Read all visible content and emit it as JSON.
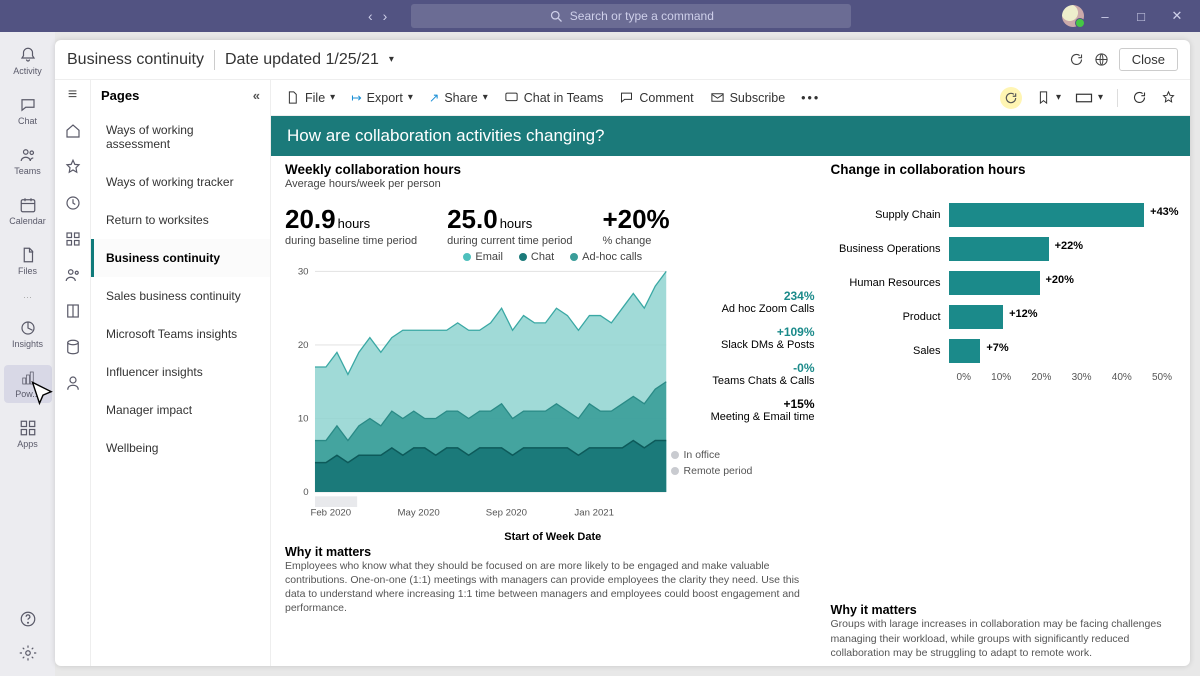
{
  "search_placeholder": "Search or type a command",
  "window": {
    "close_btn": "Close"
  },
  "teams_rail": [
    {
      "id": "activity",
      "label": "Activity"
    },
    {
      "id": "chat",
      "label": "Chat"
    },
    {
      "id": "teams",
      "label": "Teams"
    },
    {
      "id": "calendar",
      "label": "Calendar"
    },
    {
      "id": "files",
      "label": "Files"
    },
    {
      "id": "insights",
      "label": "Insights"
    },
    {
      "id": "powerbi",
      "label": "Pow..."
    },
    {
      "id": "apps",
      "label": "Apps"
    }
  ],
  "header": {
    "title": "Business continuity",
    "date": "Date updated 1/25/21"
  },
  "pages_header": "Pages",
  "pages": [
    "Ways of working assessment",
    "Ways of working tracker",
    "Return to worksites",
    "Business continuity",
    "Sales business continuity",
    "Microsoft Teams insights",
    "Influencer insights",
    "Manager impact",
    "Wellbeing"
  ],
  "pages_selected_index": 3,
  "cmd": {
    "file": "File",
    "export": "Export",
    "share": "Share",
    "chat": "Chat in Teams",
    "comment": "Comment",
    "subscribe": "Subscribe"
  },
  "banner": "How are collaboration activities changing?",
  "left": {
    "title": "Weekly collaboration hours",
    "subtitle": "Average hours/week per person",
    "m1_val": "20.9",
    "m1_unit": "hours",
    "m1_cap": "during baseline time period",
    "m2_val": "25.0",
    "m2_unit": "hours",
    "m2_cap": "during current time period",
    "m3_val": "+20%",
    "m3_cap": "% change",
    "legend": {
      "email": "Email",
      "chat": "Chat",
      "adhoc": "Ad-hoc calls"
    },
    "annot": [
      {
        "v": "234%",
        "t": "Ad hoc Zoom Calls",
        "cls": "teal"
      },
      {
        "v": "+109%",
        "t": "Slack DMs & Posts",
        "cls": "teal"
      },
      {
        "v": "-0%",
        "t": "Teams Chats & Calls",
        "cls": "teal"
      },
      {
        "v": "+15%",
        "t": "Meeting & Email time",
        "cls": ""
      }
    ],
    "period": {
      "a": "In office",
      "b": "Remote period"
    },
    "xaxis_label": "Start of Week Date",
    "why_h": "Why it matters",
    "why_t": "Employees who know what they should be focused on are more likely to be engaged and make valuable contributions. One-on-one (1:1) meetings with managers can provide employees the clarity they need. Use this data to understand where increasing 1:1 time between managers and employees could boost engagement and performance."
  },
  "right": {
    "title": "Change in collaboration hours",
    "why_h": "Why it matters",
    "why_t": "Groups with larage increases in collaboration may be facing challenges managing their workload, while groups with significantly reduced collaboration may be struggling to adapt to remote work."
  },
  "chart_data": [
    {
      "type": "area",
      "title": "Weekly collaboration hours",
      "ylabel": "Average hours/week per person",
      "xlabel": "Start of Week Date",
      "x_ticks": [
        "Feb 2020",
        "May 2020",
        "Sep 2020",
        "Jan 2021"
      ],
      "ylim": [
        0,
        30
      ],
      "series": [
        {
          "name": "Email",
          "color": "#4ec0bd",
          "values": [
            10,
            10,
            10,
            9,
            10,
            11,
            10,
            10,
            12,
            11,
            12,
            12,
            11,
            12,
            12,
            11,
            12,
            13,
            12,
            13,
            12,
            12,
            13,
            13,
            12,
            12,
            13,
            12,
            13,
            14,
            13,
            14,
            15
          ]
        },
        {
          "name": "Chat",
          "color": "#1b7a7a",
          "values": [
            4,
            4,
            5,
            4,
            5,
            5,
            5,
            6,
            5,
            6,
            6,
            5,
            6,
            6,
            5,
            6,
            6,
            6,
            5,
            6,
            6,
            6,
            6,
            6,
            5,
            6,
            6,
            6,
            6,
            7,
            6,
            7,
            7
          ]
        },
        {
          "name": "Ad-hoc calls",
          "color": "#3a9d99",
          "values": [
            3,
            3,
            4,
            3,
            4,
            5,
            4,
            5,
            5,
            5,
            4,
            5,
            5,
            5,
            5,
            5,
            5,
            6,
            5,
            5,
            5,
            5,
            6,
            5,
            5,
            6,
            5,
            5,
            6,
            6,
            6,
            7,
            8
          ]
        }
      ]
    },
    {
      "type": "bar",
      "title": "Change in collaboration hours",
      "xlabel": "",
      "ylabel": "",
      "xlim": [
        0,
        50
      ],
      "x_ticks": [
        "0%",
        "10%",
        "20%",
        "30%",
        "40%",
        "50%"
      ],
      "categories": [
        "Supply Chain",
        "Business Operations",
        "Human Resources",
        "Product",
        "Sales"
      ],
      "values": [
        43,
        22,
        20,
        12,
        7
      ],
      "value_labels": [
        "+43%",
        "+22%",
        "+20%",
        "+12%",
        "+7%"
      ]
    }
  ]
}
